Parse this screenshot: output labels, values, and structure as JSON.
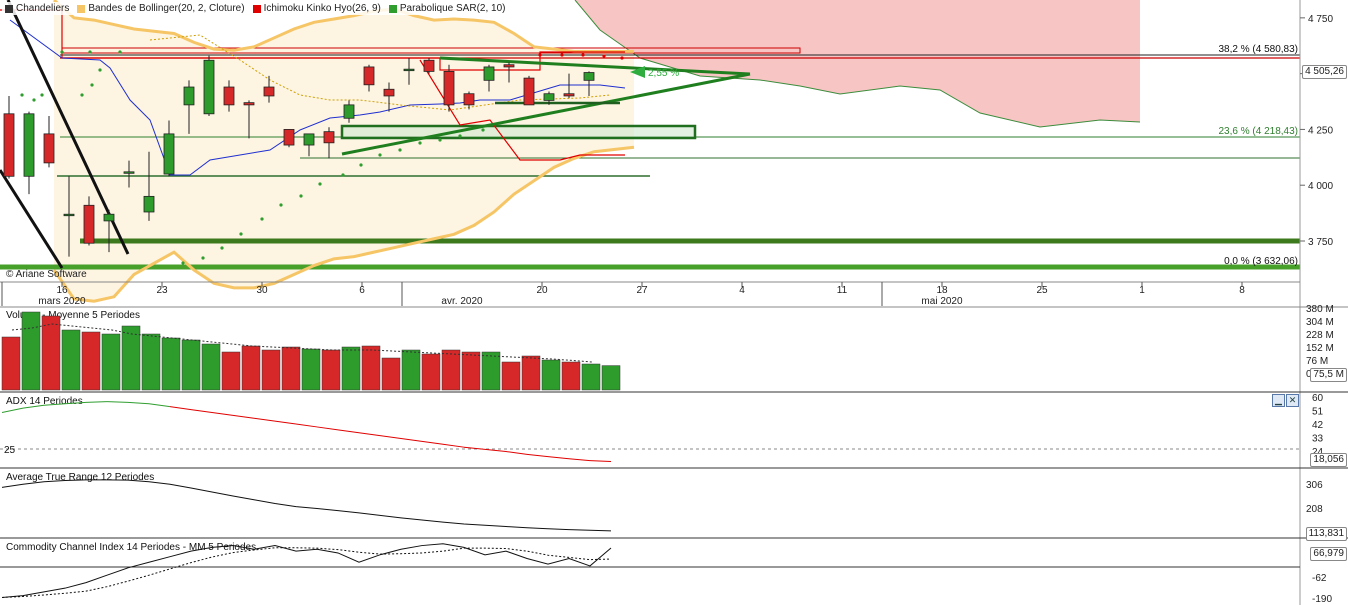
{
  "legend": [
    {
      "label": "Chandeliers",
      "color": "#333333"
    },
    {
      "label": "Bandes de Bollinger(20, 2, Cloture)",
      "color": "#f6c565"
    },
    {
      "label": "Ichimoku Kinko Hyo(26, 9)",
      "color": "#e00000"
    },
    {
      "label": "Parabolique SAR(2, 10)",
      "color": "#2f9e2f"
    }
  ],
  "watermark": "© Ariane Software",
  "price_badge": "4 505,26",
  "pct_change": "2,55 %",
  "date_axis": {
    "ticks": [
      {
        "label": "16",
        "idx": 0
      },
      {
        "label": "23",
        "idx": 5
      },
      {
        "label": "30",
        "idx": 10
      },
      {
        "label": "6",
        "idx": 15
      },
      {
        "label": "20",
        "idx": 24
      },
      {
        "label": "27",
        "idx": 29
      },
      {
        "label": "4",
        "idx": 34
      },
      {
        "label": "11",
        "idx": 39
      },
      {
        "label": "18",
        "idx": 44
      },
      {
        "label": "25",
        "idx": 49
      },
      {
        "label": "1",
        "idx": 54
      },
      {
        "label": "8",
        "idx": 59
      }
    ],
    "months": [
      {
        "label": "mars 2020",
        "idx": 0
      },
      {
        "label": "avr. 2020",
        "idx": 20
      },
      {
        "label": "mai 2020",
        "idx": 44
      }
    ]
  },
  "panels": {
    "volume": {
      "title": "Volume  - Moyenne 5 Periodes",
      "ticks": [
        "380 M",
        "304 M",
        "228 M",
        "152 M",
        "76 M",
        "0"
      ],
      "badge": "75,5 M"
    },
    "adx": {
      "title": "ADX 14 Periodes",
      "ticks": [
        "60",
        "51",
        "42",
        "33",
        "24"
      ],
      "level_label": "25",
      "badge": "18,056"
    },
    "atr": {
      "title": "Average True Range 12 Periodes",
      "ticks": [
        "306",
        "208"
      ],
      "badge": "113,831"
    },
    "cci": {
      "title": "Commodity Channel Index 14 Periodes - MM  5 Periodes",
      "ticks": [
        "66",
        "-62",
        "-190"
      ],
      "badge": "66,979"
    }
  },
  "chart_data": {
    "type": "candlestick",
    "y_ticks": [
      4750,
      4500,
      4250,
      4000,
      3750
    ],
    "ylim": [
      3620,
      4830
    ],
    "fib_levels": [
      {
        "label": "38,2 % (4 580,83)",
        "value": 4580.83
      },
      {
        "label": "23,6 % (4 218,43)",
        "value": 4218.43
      },
      {
        "label": "0,0 % (3 632,06)",
        "value": 3632.06
      }
    ],
    "candles": [
      {
        "o": 4320,
        "h": 4400,
        "l": 4030,
        "c": 4040
      },
      {
        "o": 4040,
        "h": 4330,
        "l": 3960,
        "c": 4320
      },
      {
        "o": 4230,
        "h": 4310,
        "l": 4080,
        "c": 4100
      },
      {
        "o": 3870,
        "h": 4040,
        "l": 3680,
        "c": 3870
      },
      {
        "o": 3910,
        "h": 3950,
        "l": 3730,
        "c": 3740
      },
      {
        "o": 3840,
        "h": 3890,
        "l": 3700,
        "c": 3870
      },
      {
        "o": 4060,
        "h": 4110,
        "l": 3990,
        "c": 4060
      },
      {
        "o": 3880,
        "h": 4150,
        "l": 3840,
        "c": 3950
      },
      {
        "o": 4050,
        "h": 4290,
        "l": 4040,
        "c": 4230
      },
      {
        "o": 4360,
        "h": 4470,
        "l": 4230,
        "c": 4440
      },
      {
        "o": 4320,
        "h": 4580,
        "l": 4310,
        "c": 4560
      },
      {
        "o": 4440,
        "h": 4470,
        "l": 4330,
        "c": 4360
      },
      {
        "o": 4370,
        "h": 4380,
        "l": 4210,
        "c": 4360
      },
      {
        "o": 4440,
        "h": 4490,
        "l": 4370,
        "c": 4400
      },
      {
        "o": 4250,
        "h": 4250,
        "l": 4170,
        "c": 4180
      },
      {
        "o": 4180,
        "h": 4230,
        "l": 4130,
        "c": 4230
      },
      {
        "o": 4240,
        "h": 4260,
        "l": 4120,
        "c": 4190
      },
      {
        "o": 4300,
        "h": 4380,
        "l": 4280,
        "c": 4360
      },
      {
        "o": 4530,
        "h": 4540,
        "l": 4420,
        "c": 4450
      },
      {
        "o": 4430,
        "h": 4460,
        "l": 4330,
        "c": 4400
      },
      {
        "o": 4520,
        "h": 4570,
        "l": 4450,
        "c": 4520
      },
      {
        "o": 4560,
        "h": 4570,
        "l": 4500,
        "c": 4510
      },
      {
        "o": 4510,
        "h": 4540,
        "l": 4330,
        "c": 4360
      },
      {
        "o": 4410,
        "h": 4420,
        "l": 4340,
        "c": 4360
      },
      {
        "o": 4470,
        "h": 4540,
        "l": 4420,
        "c": 4530
      },
      {
        "o": 4540,
        "h": 4550,
        "l": 4460,
        "c": 4530
      },
      {
        "o": 4480,
        "h": 4490,
        "l": 4360,
        "c": 4360
      },
      {
        "o": 4380,
        "h": 4420,
        "l": 4360,
        "c": 4410
      },
      {
        "o": 4410,
        "h": 4500,
        "l": 4390,
        "c": 4400
      },
      {
        "o": 4470,
        "h": 4510,
        "l": 4400,
        "c": 4505
      }
    ],
    "volume": [
      265,
      390,
      370,
      300,
      290,
      280,
      320,
      280,
      260,
      250,
      230,
      190,
      220,
      200,
      215,
      205,
      200,
      215,
      220,
      160,
      200,
      180,
      200,
      190,
      190,
      140,
      170,
      150,
      140,
      130,
      122
    ],
    "adx": [
      52,
      55,
      57,
      58,
      59,
      59.5,
      59,
      58,
      56,
      54,
      52,
      50,
      48,
      46,
      44,
      42,
      40,
      38,
      36,
      34,
      32,
      30,
      28,
      26.5,
      25,
      23,
      21.5,
      20,
      18.7,
      18.1
    ],
    "atr": [
      290,
      300,
      308,
      312,
      314,
      314,
      313,
      308,
      300,
      288,
      275,
      262,
      250,
      238,
      228,
      222,
      215,
      208,
      200,
      192,
      185,
      178,
      172,
      168,
      164,
      160,
      157,
      154,
      152,
      150
    ],
    "cci": [
      -200,
      -190,
      -170,
      -150,
      -120,
      -80,
      -40,
      -10,
      20,
      50,
      70,
      80,
      60,
      80,
      50,
      60,
      40,
      -10,
      30,
      60,
      80,
      90,
      70,
      30,
      50,
      10,
      -20,
      10,
      -30,
      67
    ]
  }
}
